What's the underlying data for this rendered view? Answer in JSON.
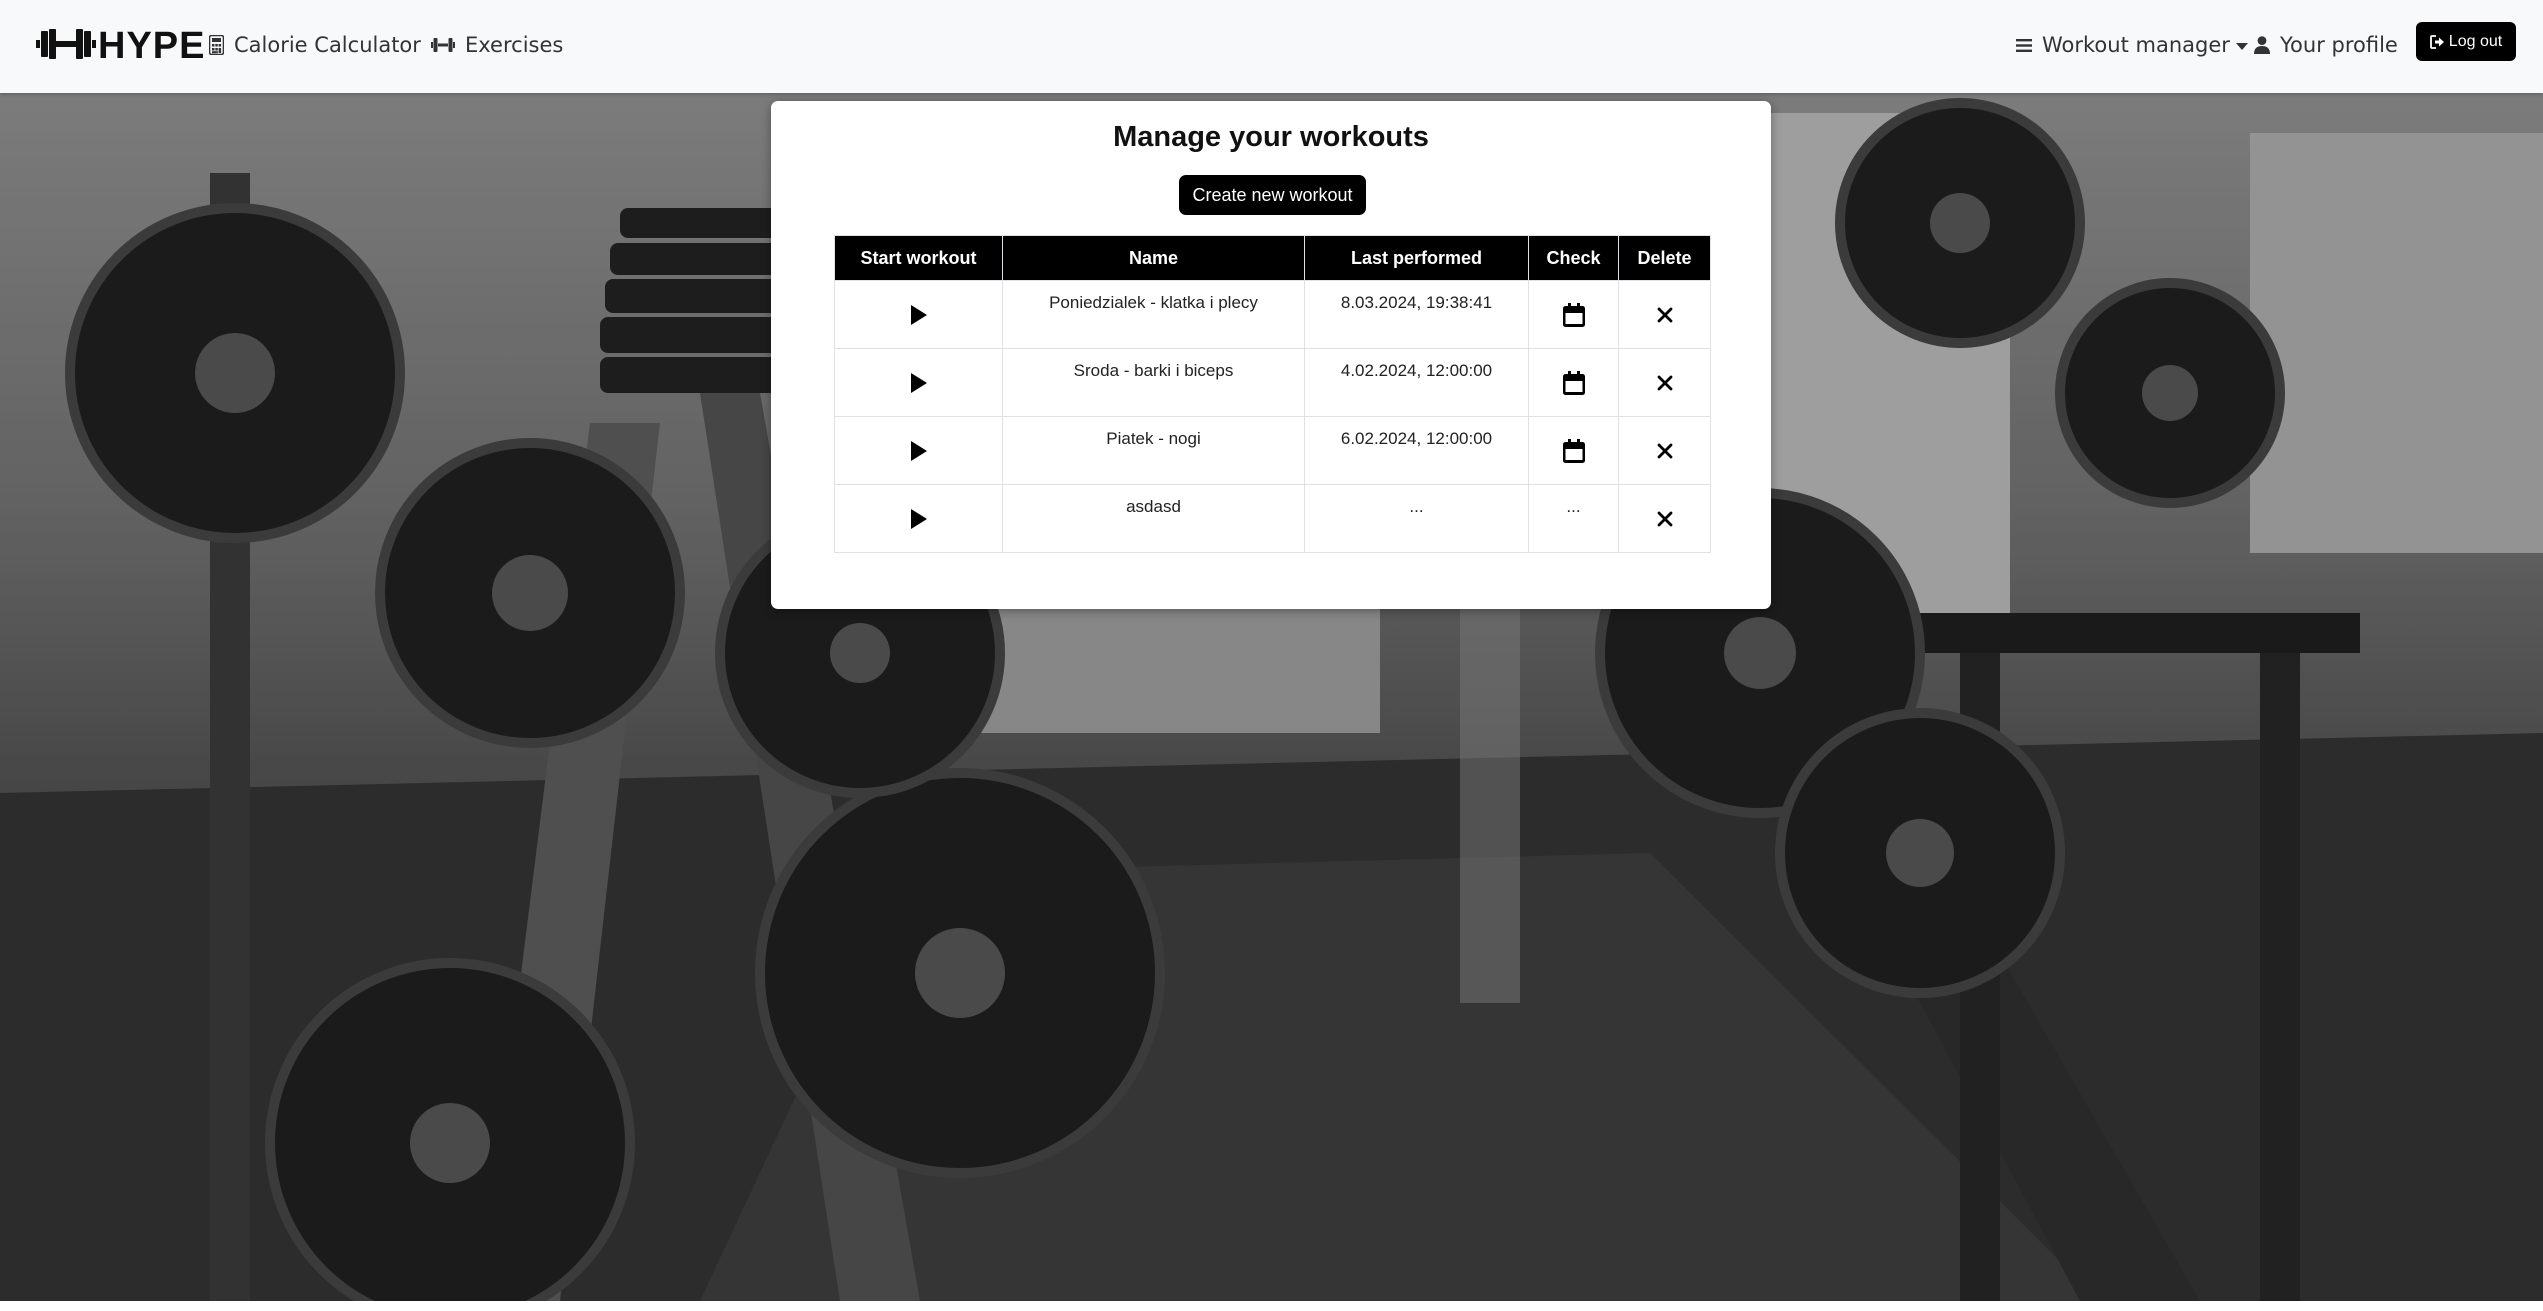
{
  "brand": {
    "name": "HYPE",
    "icon": "dumbbell-logo-icon"
  },
  "nav": {
    "calorie_calculator": {
      "label": "Calorie Calculator",
      "icon": "calculator-icon"
    },
    "exercises": {
      "label": "Exercises",
      "icon": "dumbbell-icon"
    },
    "workout_manager": {
      "label": "Workout manager",
      "icon": "bars-icon"
    },
    "profile": {
      "label": "Your profile",
      "icon": "user-icon"
    },
    "logout": {
      "label": "Log out",
      "icon": "sign-out-icon"
    }
  },
  "main": {
    "title": "Manage your workouts",
    "create_button": "Create new workout",
    "table": {
      "headers": {
        "start": "Start workout",
        "name": "Name",
        "last_performed": "Last performed",
        "check": "Check",
        "delete": "Delete"
      },
      "rows": [
        {
          "name": "Poniedzialek - klatka i plecy",
          "last_performed": "8.03.2024, 19:38:41",
          "check": "calendar-icon"
        },
        {
          "name": "Sroda - barki i biceps",
          "last_performed": "4.02.2024, 12:00:00",
          "check": "calendar-icon"
        },
        {
          "name": "Piatek - nogi",
          "last_performed": "6.02.2024, 12:00:00",
          "check": "calendar-icon"
        },
        {
          "name": "asdasd",
          "last_performed": "...",
          "check_text": "..."
        }
      ]
    }
  },
  "colors": {
    "navbar_bg": "#f8f9fa",
    "button_bg": "#000000",
    "header_bg": "#000000"
  }
}
